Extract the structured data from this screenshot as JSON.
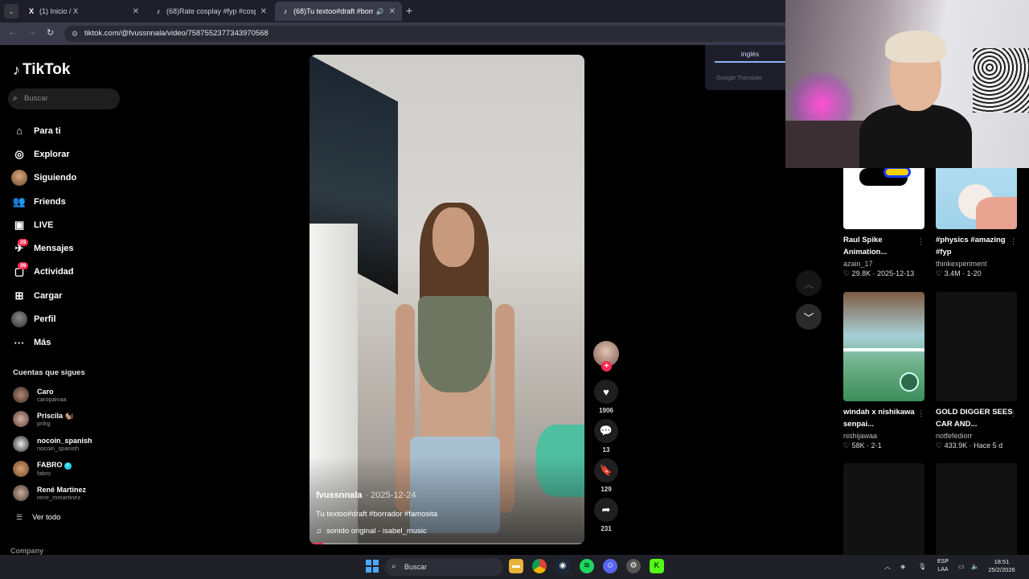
{
  "browser": {
    "tabs": [
      {
        "label": "(1) Inicio / X",
        "favicon": "X"
      },
      {
        "label": "(68)Rate cosplay #fyp #cosplay",
        "favicon": "♪"
      },
      {
        "label": "(68)Tu textoo#draft #borrad",
        "favicon": "♪"
      }
    ],
    "url": "tiktok.com/@fvussnnala/video/7587552377343970568"
  },
  "translate": {
    "language": "inglés",
    "powered_by": "Google Translate"
  },
  "tiktok": {
    "logo": "TikTok",
    "search_placeholder": "Buscar",
    "nav": [
      {
        "label": "Para ti",
        "icon": "home-icon"
      },
      {
        "label": "Explorar",
        "icon": "compass-icon"
      },
      {
        "label": "Siguiendo",
        "icon": "avatar"
      },
      {
        "label": "Friends",
        "icon": "friends-icon"
      },
      {
        "label": "LIVE",
        "icon": "live-icon"
      },
      {
        "label": "Mensajes",
        "icon": "messages-icon",
        "badge": "29"
      },
      {
        "label": "Actividad",
        "icon": "activity-icon",
        "badge": "39"
      },
      {
        "label": "Cargar",
        "icon": "upload-icon"
      },
      {
        "label": "Perfil",
        "icon": "profile-avatar"
      },
      {
        "label": "Más",
        "icon": "more-icon"
      }
    ],
    "following_title": "Cuentas que sigues",
    "following": [
      {
        "name": "Caro",
        "handle": "caropaivaa"
      },
      {
        "name": "Priscila 🐿️",
        "handle": "prilrg"
      },
      {
        "name": "nocoin_spanish",
        "handle": "nocoin_spanish"
      },
      {
        "name": "FABRO",
        "handle": "fabro",
        "verified": true
      },
      {
        "name": "René Martínez",
        "handle": "rene_mmartinez"
      }
    ],
    "see_all": "Ver todo",
    "company": "Company"
  },
  "video": {
    "author": "fvussnnala",
    "date": "· 2025-12-24",
    "description": "Tu textoo#draft #borrador #famosita",
    "music": "sonido original - isabel_music",
    "progress": 0.05,
    "likes": "1906",
    "comments": "13",
    "saves": "129",
    "shares": "231"
  },
  "recommended": [
    {
      "title": "Raul Spike Animation...",
      "author": "azain_17",
      "stats": "29.8K · 2025-12-13"
    },
    {
      "title": "#physics #amazing #fyp",
      "author": "thinkexperiment",
      "stats": "3.4M · 1-20"
    },
    {
      "title": "windah x nishikawa senpai...",
      "author": "nishijawaa",
      "stats": "58K · 2-1"
    },
    {
      "title": "GOLD DIGGER SEES CAR AND...",
      "author": "notfefediorr",
      "stats": "433.9K · Hace 5 d"
    }
  ],
  "taskbar": {
    "search": "Buscar",
    "lang_top": "ESP",
    "lang_bottom": "LAA",
    "time": "18:51",
    "date": "25/2/2026"
  }
}
